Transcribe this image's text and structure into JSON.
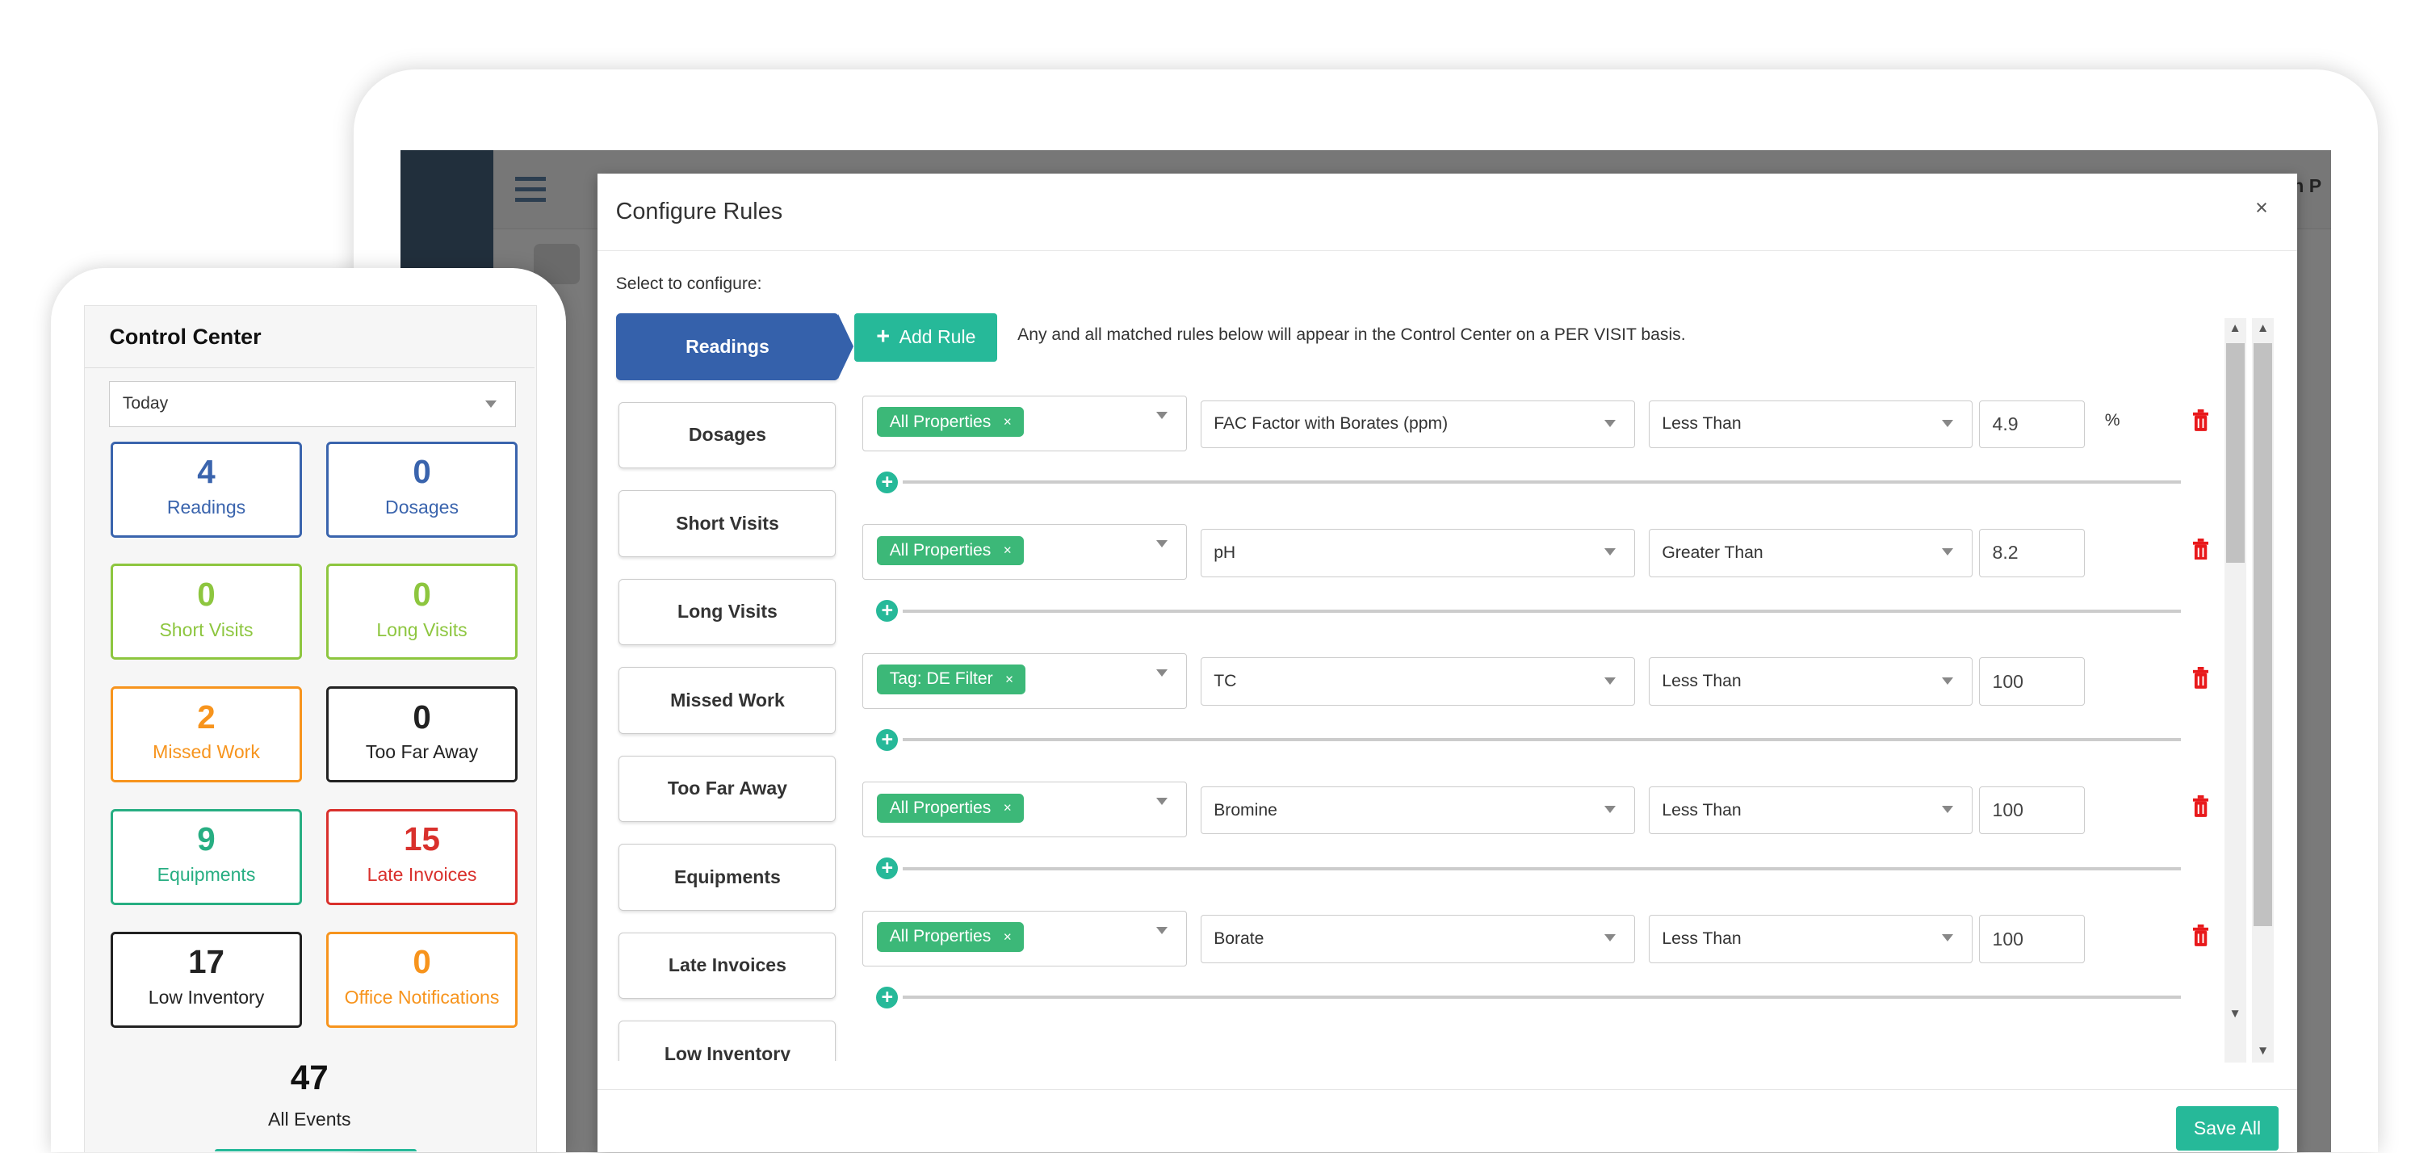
{
  "colors": {
    "primary": "#3561ab",
    "accent": "#26b999",
    "tag": "#3cb878",
    "danger": "#e8191b"
  },
  "app": {
    "partial_header_text": "n P"
  },
  "modal": {
    "title": "Configure Rules",
    "close_label": "×",
    "select_label": "Select to configure:",
    "add_rule_label": "Add Rule",
    "info_text": "Any and all matched rules below will appear in the Control Center on a PER VISIT basis.",
    "save_label": "Save All",
    "tabs": [
      {
        "label": "Readings",
        "active": true
      },
      {
        "label": "Dosages"
      },
      {
        "label": "Short Visits"
      },
      {
        "label": "Long Visits"
      },
      {
        "label": "Missed Work"
      },
      {
        "label": "Too Far Away"
      },
      {
        "label": "Equipments"
      },
      {
        "label": "Late Invoices"
      },
      {
        "label": "Low Inventory"
      }
    ],
    "rules": [
      {
        "tag": "All Properties",
        "metric": "FAC Factor with Borates (ppm)",
        "operator": "Less Than",
        "value": "4.9",
        "unit": "%"
      },
      {
        "tag": "All Properties",
        "metric": "pH",
        "operator": "Greater Than",
        "value": "8.2",
        "unit": ""
      },
      {
        "tag": "Tag: DE Filter",
        "metric": "TC",
        "operator": "Less Than",
        "value": "100",
        "unit": ""
      },
      {
        "tag": "All Properties",
        "metric": "Bromine",
        "operator": "Less Than",
        "value": "100",
        "unit": ""
      },
      {
        "tag": "All Properties",
        "metric": "Borate",
        "operator": "Less Than",
        "value": "100",
        "unit": ""
      }
    ]
  },
  "control_center": {
    "title": "Control Center",
    "period": "Today",
    "cards": [
      {
        "count": "4",
        "label": "Readings",
        "color": "#3a64ad",
        "text": "#3a64ad"
      },
      {
        "count": "0",
        "label": "Dosages",
        "color": "#3a64ad",
        "text": "#3a64ad"
      },
      {
        "count": "0",
        "label": "Short Visits",
        "color": "#8dc63f",
        "text": "#8dc63f"
      },
      {
        "count": "0",
        "label": "Long Visits",
        "color": "#8dc63f",
        "text": "#8dc63f"
      },
      {
        "count": "2",
        "label": "Missed Work",
        "color": "#f7941d",
        "text": "#f7941d"
      },
      {
        "count": "0",
        "label": "Too Far Away",
        "color": "#222222",
        "text": "#222222"
      },
      {
        "count": "9",
        "label": "Equipments",
        "color": "#27ae82",
        "text": "#27ae82"
      },
      {
        "count": "15",
        "label": "Late Invoices",
        "color": "#d9302c",
        "text": "#d9302c"
      },
      {
        "count": "17",
        "label": "Low Inventory",
        "color": "#222222",
        "text": "#222222"
      },
      {
        "count": "0",
        "label": "Office Notifications",
        "color": "#f7941d",
        "text": "#f7941d"
      }
    ],
    "total": "47",
    "total_label": "All Events"
  }
}
